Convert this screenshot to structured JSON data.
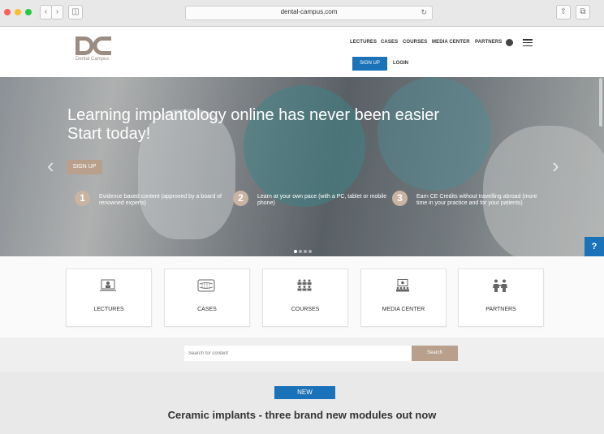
{
  "browser": {
    "url": "dental-campus.com",
    "buttons": {
      "back": "‹",
      "forward": "›",
      "sidebar": "◫",
      "reload": "↻",
      "share": "⇧",
      "tabs": "⧉"
    },
    "traffic_lights": [
      "#fc5f57",
      "#fdbc2e",
      "#28c840"
    ]
  },
  "header": {
    "logo_text": "Dental Campus",
    "nav": [
      "LECTURES",
      "CASES",
      "COURSES",
      "MEDIA CENTER",
      "PARTNERS"
    ],
    "signup": "SIGN UP",
    "login": "LOGIN",
    "brand_color": "#1a72b8"
  },
  "hero": {
    "headline_line1": "Learning implantology online has never been easier",
    "headline_line2": "Start today!",
    "signup": "SIGN UP",
    "prev_arrow": "‹",
    "next_arrow": "›",
    "steps": [
      {
        "num": "1",
        "text": "Evidence based content (approved by a board of renowned experts)"
      },
      {
        "num": "2",
        "text": "Learn at your own pace (with a PC, tablet or mobile phone)"
      },
      {
        "num": "3",
        "text": "Earn CE Credits without travelling abroad (more time in your practice and for your patients)"
      }
    ],
    "slide_count": 4,
    "active_slide": 1
  },
  "help_button": "?",
  "tiles": [
    {
      "label": "LECTURES",
      "icon": "lecture-icon"
    },
    {
      "label": "CASES",
      "icon": "teeth-icon"
    },
    {
      "label": "COURSES",
      "icon": "audience-icon"
    },
    {
      "label": "MEDIA CENTER",
      "icon": "presentation-icon"
    },
    {
      "label": "PARTNERS",
      "icon": "partners-icon"
    }
  ],
  "search": {
    "placeholder": "Search for content",
    "button": "Search"
  },
  "new_section": {
    "badge": "NEW",
    "title": "Ceramic implants - three brand new modules out now"
  }
}
